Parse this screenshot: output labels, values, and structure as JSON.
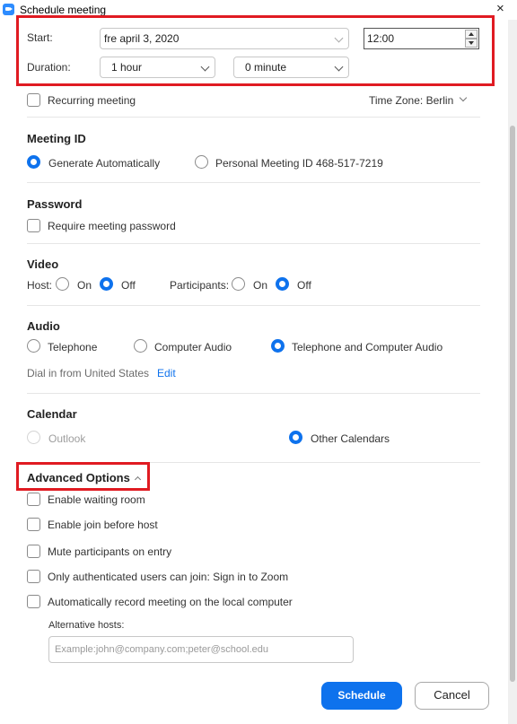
{
  "window": {
    "title": "Schedule meeting",
    "close_glyph": "×"
  },
  "start": {
    "label": "Start:",
    "date_value": "fre  april 3, 2020",
    "time_value": "12:00"
  },
  "duration": {
    "label": "Duration:",
    "hours_value": "1 hour",
    "minutes_value": "0 minute"
  },
  "recurring": {
    "label": "Recurring meeting",
    "checked": false
  },
  "timezone": {
    "label": "Time Zone: Berlin"
  },
  "meeting_id": {
    "title": "Meeting ID",
    "generate_label": "Generate Automatically",
    "personal_label": "Personal Meeting ID 468-517-7219",
    "selected": "generate"
  },
  "password": {
    "title": "Password",
    "require_label": "Require meeting password"
  },
  "video": {
    "title": "Video",
    "host_label": "Host:",
    "host_on": "On",
    "host_off": "Off",
    "participants_label": "Participants:",
    "participants_on": "On",
    "participants_off": "Off",
    "host_selected": "off",
    "participants_selected": "off"
  },
  "audio": {
    "title": "Audio",
    "telephone": "Telephone",
    "computer": "Computer Audio",
    "both": "Telephone and Computer Audio",
    "selected": "both",
    "dial_in": "Dial in from United States",
    "edit": "Edit"
  },
  "calendar": {
    "title": "Calendar",
    "outlook": "Outlook",
    "other": "Other Calendars",
    "selected": "other"
  },
  "advanced": {
    "title": "Advanced Options",
    "waiting_room": "Enable waiting room",
    "join_before_host": "Enable join before host",
    "mute_on_entry": "Mute participants on entry",
    "auth_only": "Only authenticated users can join: Sign in to Zoom",
    "auto_record": "Automatically record meeting on the local computer",
    "alt_hosts_label": "Alternative hosts:",
    "alt_hosts_placeholder": "Example:john@company.com;peter@school.edu"
  },
  "buttons": {
    "schedule": "Schedule",
    "cancel": "Cancel"
  },
  "colors": {
    "accent": "#0E72ED",
    "highlight": "#E01B22"
  },
  "icons": [
    "zoom-app-icon",
    "close-icon",
    "chevron-down-icon",
    "chevron-up-icon",
    "spin-up-icon",
    "spin-down-icon"
  ]
}
